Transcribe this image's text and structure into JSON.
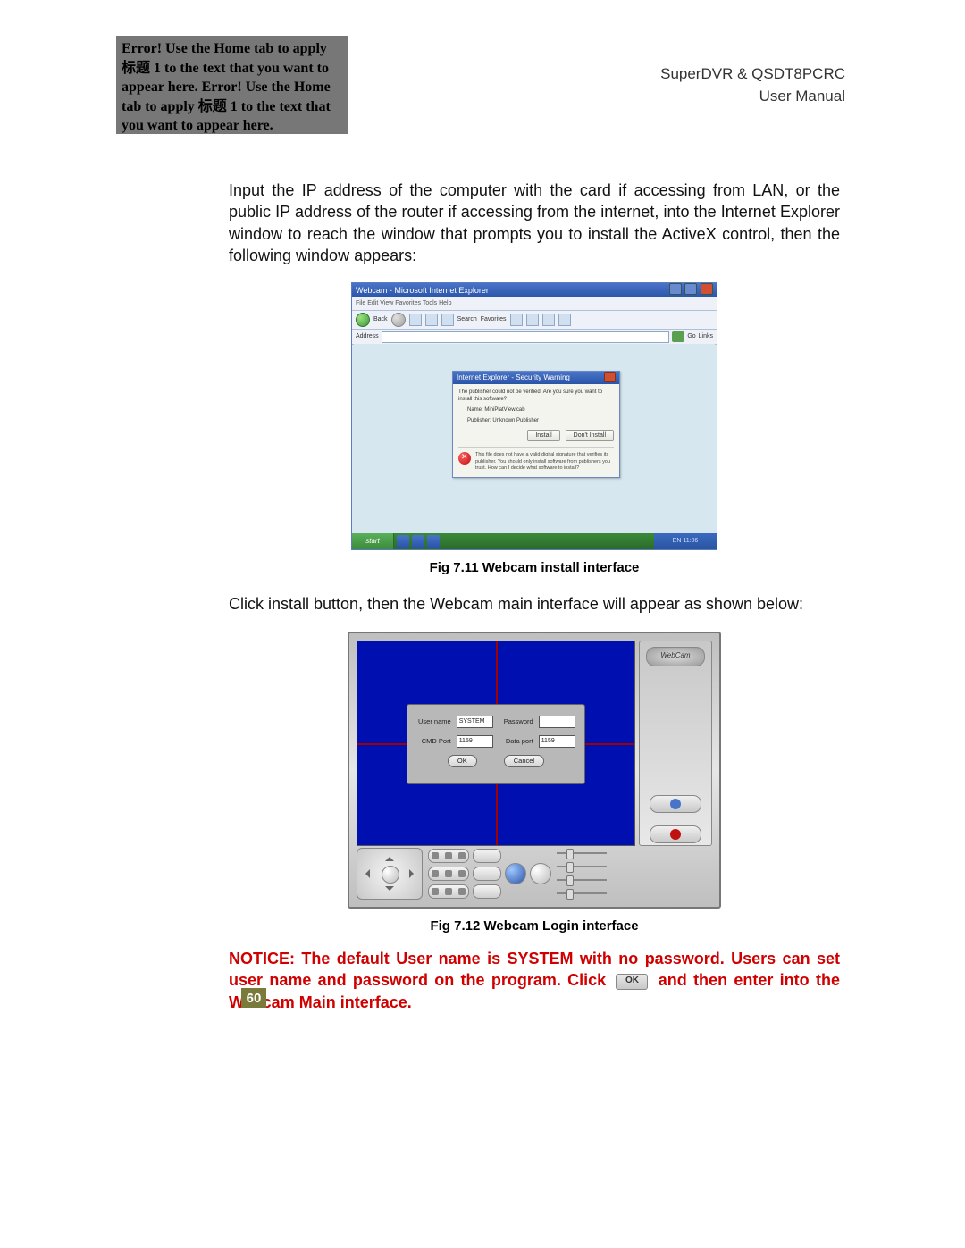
{
  "header": {
    "error_text": "Error! Use the Home tab to apply 标题 1 to the text that you want to appear here. Error! Use the Home tab to apply 标题 1 to the text that you want to appear here.",
    "line1": "SuperDVR & QSDT8PCRC",
    "line2": "User  Manual"
  },
  "body": {
    "para1": "Input the IP address of the computer with the card if accessing from LAN, or the public IP address of the router if accessing from the internet, into the Internet Explorer window to reach the window that prompts you to install the ActiveX control, then the following window appears:",
    "fig1_caption": "Fig 7.11 Webcam install interface",
    "para2": "Click install button, then the Webcam main interface will appear as shown below:",
    "fig2_caption": "Fig 7.12 Webcam Login interface",
    "notice_a": "NOTICE: The default User name is SYSTEM with no password. Users can set user name and password on the program. Click",
    "notice_b": "and then enter into the Webcam Main interface.",
    "ok_label": "OK"
  },
  "fig711": {
    "title": "Webcam - Microsoft Internet Explorer",
    "menu": "File   Edit   View   Favorites   Tools   Help",
    "tool_back": "Back",
    "tool_search": "Search",
    "tool_fav": "Favorites",
    "addr_label": "Address",
    "go": "Go",
    "links": "Links",
    "dialog_title": "Internet Explorer - Security Warning",
    "dialog_msg": "The publisher could not be verified. Are you sure you want to install this software?",
    "dialog_name": "Name: MiniPlatView.cab",
    "dialog_pub": "Publisher: Unknown Publisher",
    "btn_install": "Install",
    "btn_dont": "Don't Install",
    "warn": "This file does not have a valid digital signature that verifies its publisher. You should only install software from publishers you trust. How can I decide what software to install?",
    "start": "start",
    "tray": "EN  11:06"
  },
  "fig712": {
    "logo": "WebCam",
    "username_label": "User name",
    "username_value": "SYSTEM",
    "password_label": "Password",
    "cmdport_label": "CMD Port",
    "cmdport_value": "1159",
    "dataport_label": "Data port",
    "dataport_value": "1159",
    "ok": "OK",
    "cancel": "Cancel"
  },
  "page_number": "60"
}
